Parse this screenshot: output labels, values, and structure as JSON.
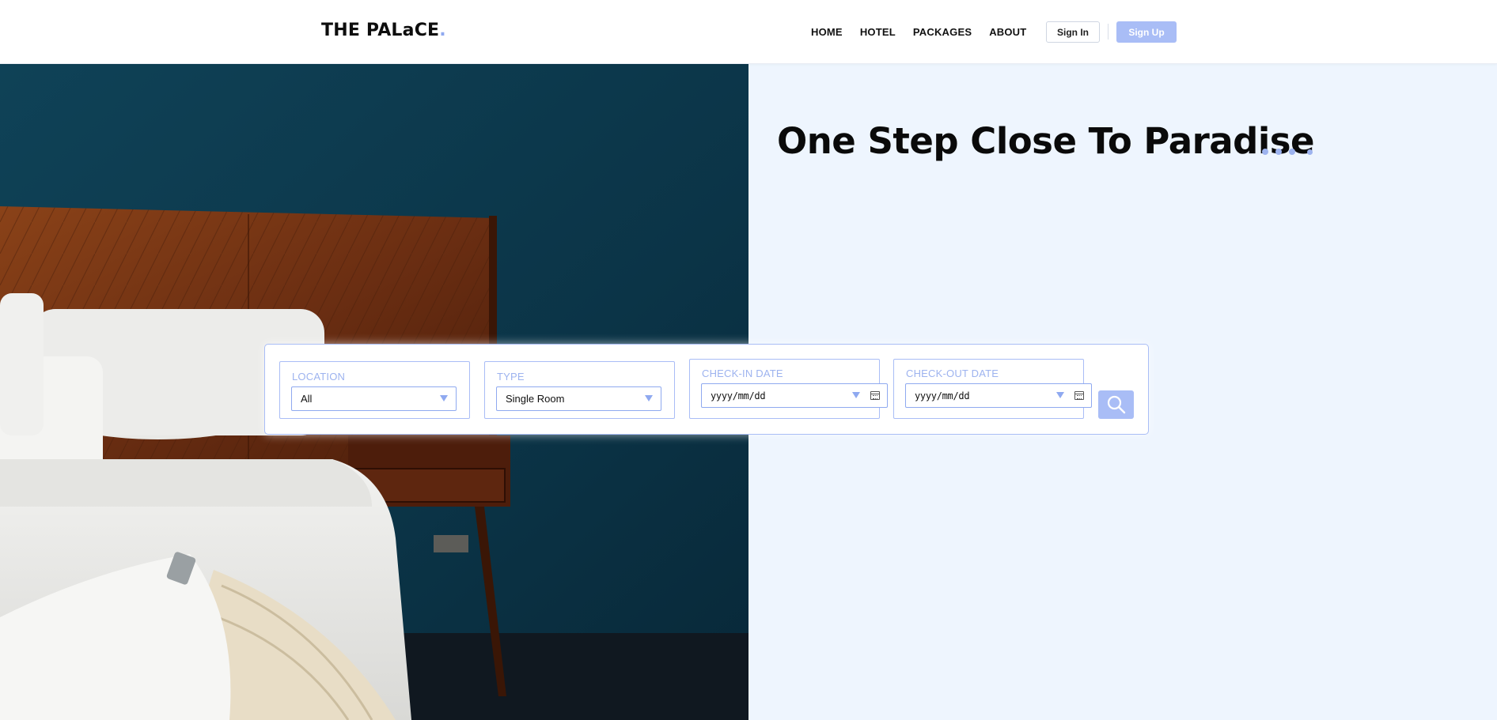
{
  "brand": {
    "name": "THE PALaCE",
    "dot": "."
  },
  "nav": {
    "items": [
      "HOME",
      "HOTEL",
      "PACKAGES",
      "ABOUT"
    ],
    "sign_in": "Sign In",
    "sign_up": "Sign Up"
  },
  "hero": {
    "headline": "One Step Close To Paradise",
    "image_icon": "bedroom-photo"
  },
  "search": {
    "location": {
      "label": "LOCATION",
      "value": "All"
    },
    "type": {
      "label": "TYPE",
      "value": "Single Room"
    },
    "check_in": {
      "label": "CHECK-IN DATE",
      "placeholder": "yyyy/mm/dd"
    },
    "check_out": {
      "label": "CHECK-OUT DATE",
      "placeholder": "yyyy/mm/dd"
    },
    "button_icon": "search-icon"
  },
  "colors": {
    "accent": "#a9bdf6",
    "hero_bg": "#eef5fe",
    "text": "#0a0a0a"
  }
}
